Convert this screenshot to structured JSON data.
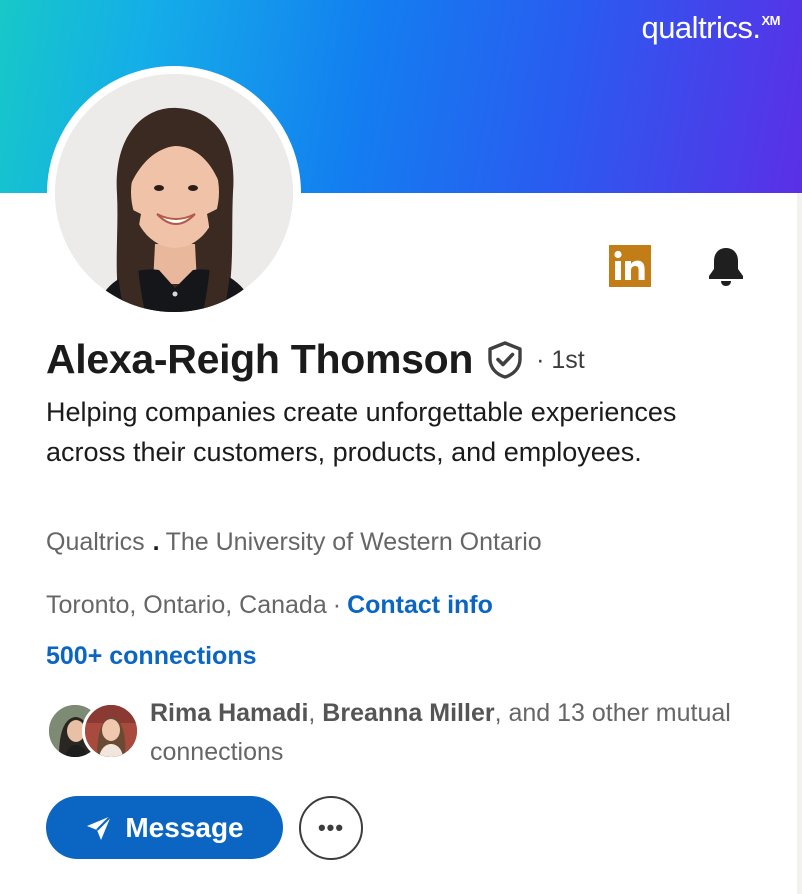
{
  "banner": {
    "brand_text": "qualtrics.",
    "brand_sup": "XM",
    "gradient_colors": [
      "#17c8c8",
      "#14aee8",
      "#137ef0",
      "#2a5bf0",
      "#5b2fe6"
    ]
  },
  "profile": {
    "name": "Alexa-Reigh Thomson",
    "verified_icon": "shield-check-icon",
    "degree": "· 1st",
    "headline": "Helping companies create unforgettable experiences across their customers, products, and employees.",
    "company": "Qualtrics",
    "org_separator": ".",
    "school": "The University of Western Ontario",
    "location": "Toronto, Ontario, Canada",
    "location_separator": "·",
    "contact_info_label": "Contact info",
    "connections_label": "500+ connections"
  },
  "mutual": {
    "name_1": "Rima Hamadi",
    "separator": ",",
    "name_2": "Breanna Miller",
    "rest": ", and 13 other mutual connections"
  },
  "actions": {
    "message_label": "Message",
    "more_label": "•••",
    "linkedin_icon": "linkedin-icon",
    "bell_icon": "bell-icon"
  },
  "colors": {
    "link": "#0a66c2",
    "primary_button": "#0a66c2",
    "linkedin_badge": "#c37d16",
    "text_primary": "#1b1b1b",
    "text_secondary": "#666666"
  }
}
